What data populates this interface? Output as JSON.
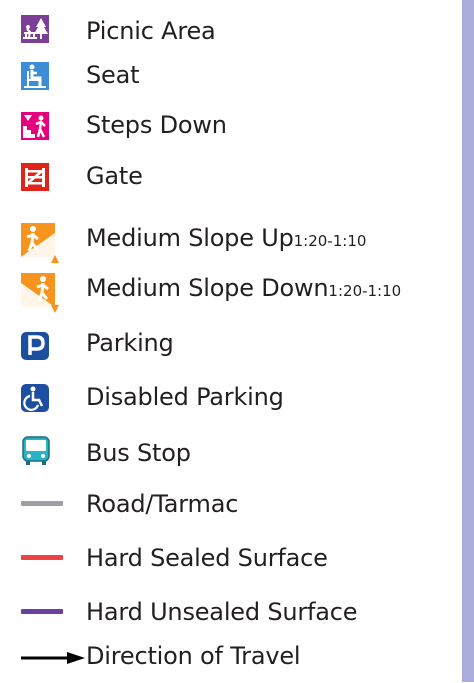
{
  "legend": {
    "items": [
      {
        "label": "Picnic Area",
        "icon": "picnic-area-icon",
        "color": "#7b3f98"
      },
      {
        "label": "Seat",
        "icon": "seat-icon",
        "color": "#3c8dd6"
      },
      {
        "label": "Steps Down",
        "icon": "steps-down-icon",
        "color": "#e6007e"
      },
      {
        "label": "Gate",
        "icon": "gate-icon",
        "color": "#e2231a"
      },
      {
        "label": "Medium Slope Up",
        "ratio": "1:20-1:10",
        "icon": "slope-up-icon",
        "color": "#f7941d"
      },
      {
        "label": "Medium Slope Down",
        "ratio": "1:20-1:10",
        "icon": "slope-down-icon",
        "color": "#f7941d"
      },
      {
        "label": "Parking",
        "icon": "parking-icon",
        "color": "#1d4fa1"
      },
      {
        "label": "Disabled Parking",
        "icon": "disabled-parking-icon",
        "color": "#1d4fa1"
      },
      {
        "label": "Bus Stop",
        "icon": "bus-stop-icon",
        "color": "#29b3c5"
      },
      {
        "label": "Road/Tarmac",
        "icon": "grey-line",
        "color": "#9d9fa2"
      },
      {
        "label": "Hard Sealed Surface",
        "icon": "red-line",
        "color": "#ef4044"
      },
      {
        "label": "Hard Unsealed Surface",
        "icon": "purple-line",
        "color": "#6b3fa0"
      },
      {
        "label": "Direction of Travel",
        "icon": "arrow-right-icon",
        "color": "#000000"
      }
    ]
  },
  "side_bar_color": "#a9addb"
}
